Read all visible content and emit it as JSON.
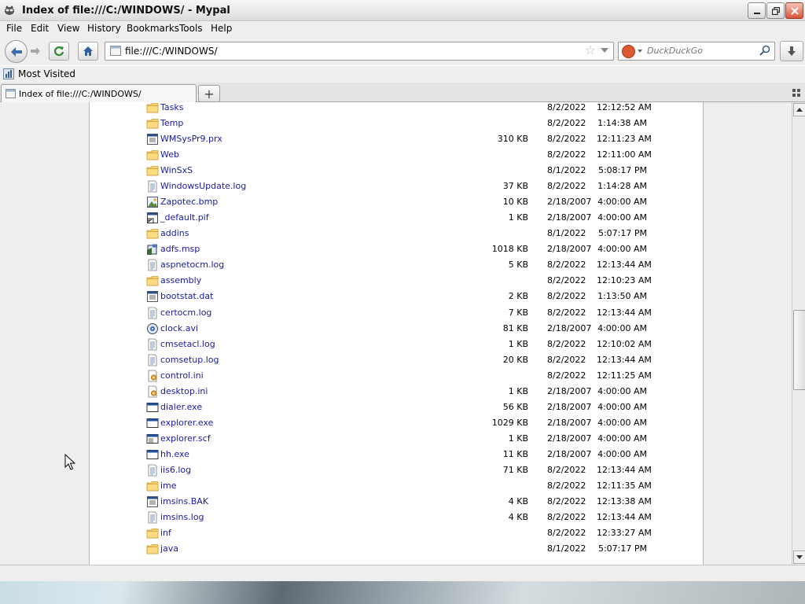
{
  "window": {
    "title": "Index of file:///C:/WINDOWS/ - Mypal"
  },
  "menu": [
    "File",
    "Edit",
    "View",
    "History",
    "Bookmarks",
    "Tools",
    "Help"
  ],
  "nav": {
    "url": "file:///C:/WINDOWS/",
    "search_placeholder": "DuckDuckGo"
  },
  "bookmarks": {
    "most_visited": "Most Visited"
  },
  "tab": {
    "label": "Index of file:///C:/WINDOWS/"
  },
  "files": [
    {
      "name": "Tasks",
      "type": "folder",
      "size": "",
      "date": "8/2/2022",
      "time": "12:12:52 AM"
    },
    {
      "name": "Temp",
      "type": "folder",
      "size": "",
      "date": "8/2/2022",
      "time": "1:14:38 AM"
    },
    {
      "name": "WMSysPr9.prx",
      "type": "gen",
      "size": "310 KB",
      "date": "8/2/2022",
      "time": "12:11:23 AM"
    },
    {
      "name": "Web",
      "type": "folder",
      "size": "",
      "date": "8/2/2022",
      "time": "12:11:00 AM"
    },
    {
      "name": "WinSxS",
      "type": "folder",
      "size": "",
      "date": "8/1/2022",
      "time": "5:08:17 PM"
    },
    {
      "name": "WindowsUpdate.log",
      "type": "txt",
      "size": "37 KB",
      "date": "8/2/2022",
      "time": "1:14:28 AM"
    },
    {
      "name": "Zapotec.bmp",
      "type": "bmp",
      "size": "10 KB",
      "date": "2/18/2007",
      "time": "4:00:00 AM"
    },
    {
      "name": "_default.pif",
      "type": "pif",
      "size": "1 KB",
      "date": "2/18/2007",
      "time": "4:00:00 AM"
    },
    {
      "name": "addins",
      "type": "folder",
      "size": "",
      "date": "8/1/2022",
      "time": "5:07:17 PM"
    },
    {
      "name": "adfs.msp",
      "type": "msp",
      "size": "1018 KB",
      "date": "2/18/2007",
      "time": "4:00:00 AM"
    },
    {
      "name": "aspnetocm.log",
      "type": "txt",
      "size": "5 KB",
      "date": "8/2/2022",
      "time": "12:13:44 AM"
    },
    {
      "name": "assembly",
      "type": "folder",
      "size": "",
      "date": "8/2/2022",
      "time": "12:10:23 AM"
    },
    {
      "name": "bootstat.dat",
      "type": "gen",
      "size": "2 KB",
      "date": "8/2/2022",
      "time": "1:13:50 AM"
    },
    {
      "name": "certocm.log",
      "type": "txt",
      "size": "7 KB",
      "date": "8/2/2022",
      "time": "12:13:44 AM"
    },
    {
      "name": "clock.avi",
      "type": "avi",
      "size": "81 KB",
      "date": "2/18/2007",
      "time": "4:00:00 AM"
    },
    {
      "name": "cmsetacl.log",
      "type": "txt",
      "size": "1 KB",
      "date": "8/2/2022",
      "time": "12:10:02 AM"
    },
    {
      "name": "comsetup.log",
      "type": "txt",
      "size": "20 KB",
      "date": "8/2/2022",
      "time": "12:13:44 AM"
    },
    {
      "name": "control.ini",
      "type": "ini",
      "size": "",
      "date": "8/2/2022",
      "time": "12:11:25 AM"
    },
    {
      "name": "desktop.ini",
      "type": "ini",
      "size": "1 KB",
      "date": "2/18/2007",
      "time": "4:00:00 AM"
    },
    {
      "name": "dialer.exe",
      "type": "exe",
      "size": "56 KB",
      "date": "2/18/2007",
      "time": "4:00:00 AM"
    },
    {
      "name": "explorer.exe",
      "type": "exe",
      "size": "1029 KB",
      "date": "2/18/2007",
      "time": "4:00:00 AM"
    },
    {
      "name": "explorer.scf",
      "type": "scf",
      "size": "1 KB",
      "date": "2/18/2007",
      "time": "4:00:00 AM"
    },
    {
      "name": "hh.exe",
      "type": "exe",
      "size": "11 KB",
      "date": "2/18/2007",
      "time": "4:00:00 AM"
    },
    {
      "name": "iis6.log",
      "type": "txt",
      "size": "71 KB",
      "date": "8/2/2022",
      "time": "12:13:44 AM"
    },
    {
      "name": "ime",
      "type": "folder",
      "size": "",
      "date": "8/2/2022",
      "time": "12:11:35 AM"
    },
    {
      "name": "imsins.BAK",
      "type": "gen",
      "size": "4 KB",
      "date": "8/2/2022",
      "time": "12:13:38 AM"
    },
    {
      "name": "imsins.log",
      "type": "txt",
      "size": "4 KB",
      "date": "8/2/2022",
      "time": "12:13:44 AM"
    },
    {
      "name": "inf",
      "type": "folder",
      "size": "",
      "date": "8/2/2022",
      "time": "12:33:27 AM"
    },
    {
      "name": "java",
      "type": "folder",
      "size": "",
      "date": "8/1/2022",
      "time": "5:07:17 PM"
    }
  ]
}
